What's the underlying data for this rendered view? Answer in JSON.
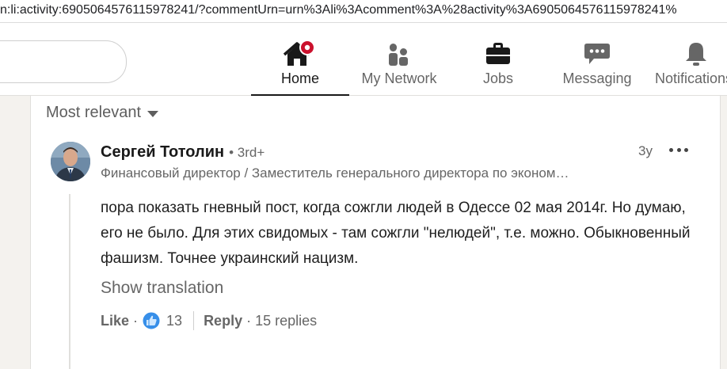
{
  "browser": {
    "url_fragment": "n:li:activity:6905064576115978241/?commentUrn=urn%3Ali%3Acomment%3A%28activity%3A6905064576115978241%"
  },
  "nav": {
    "items": [
      {
        "label": "Home",
        "icon": "home-icon",
        "active": true
      },
      {
        "label": "My Network",
        "icon": "network-icon"
      },
      {
        "label": "Jobs",
        "icon": "jobs-icon"
      },
      {
        "label": "Messaging",
        "icon": "messaging-icon"
      },
      {
        "label": "Notifications",
        "icon": "bell-icon"
      }
    ]
  },
  "comments": {
    "sort_label": "Most relevant",
    "comment": {
      "author": "Сергей Тотолин",
      "degree": "• 3rd+",
      "headline": "Финансовый директор / Заместитель генерального директора по эконом…",
      "timestamp": "3y",
      "text": "пора показать гневный пост, когда сожгли людей в Одессе 02 мая 2014г. Но думаю, его не было. Для этих свидомых - там сожгли \"нелюдей\", т.е. можно. Обыкновенный фашизм. Точнее украинский нацизм.",
      "show_translation": "Show translation",
      "like_label": "Like",
      "like_separator": "·",
      "like_count": "13",
      "reply_label": "Reply",
      "reply_separator": "·",
      "replies_label": "15 replies"
    }
  },
  "colors": {
    "notification_badge": "#cb112d",
    "like_blue": "#378fe9"
  }
}
